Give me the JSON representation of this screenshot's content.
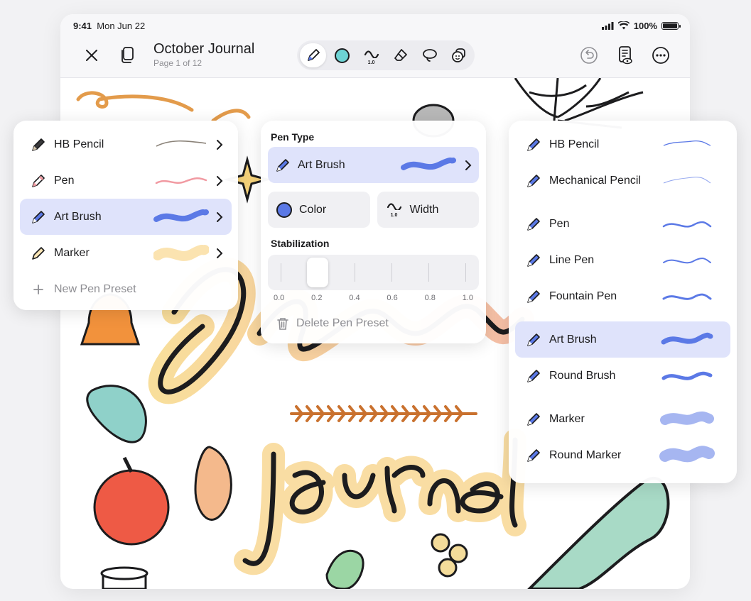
{
  "status": {
    "time": "9:41",
    "date": "Mon Jun 22",
    "battery": "100%"
  },
  "document": {
    "title": "October Journal",
    "subtitle": "Page 1 of 12"
  },
  "toolbar": {
    "width_value": "1.0"
  },
  "left_panel": {
    "items": [
      {
        "label": "HB Pencil",
        "selected": false
      },
      {
        "label": "Pen",
        "selected": false
      },
      {
        "label": "Art Brush",
        "selected": true
      },
      {
        "label": "Marker",
        "selected": false
      }
    ],
    "new_preset_label": "New Pen Preset"
  },
  "middle_panel": {
    "pen_type_heading": "Pen Type",
    "pen_type_value": "Art Brush",
    "color_label": "Color",
    "width_label": "Width",
    "width_badge": "1.0",
    "stabilization_heading": "Stabilization",
    "stabilization_value": 0.2,
    "scale": [
      "0.0",
      "0.2",
      "0.4",
      "0.6",
      "0.8",
      "1.0"
    ],
    "delete_label": "Delete Pen Preset"
  },
  "right_panel": {
    "items": [
      {
        "label": "HB Pencil"
      },
      {
        "label": "Mechanical Pencil"
      },
      {
        "label": "Pen"
      },
      {
        "label": "Line Pen"
      },
      {
        "label": "Fountain Pen"
      },
      {
        "label": "Art Brush",
        "selected": true
      },
      {
        "label": "Round Brush"
      },
      {
        "label": "Marker"
      },
      {
        "label": "Round Marker"
      }
    ]
  },
  "colors": {
    "accent": "#5b79e6",
    "selection": "#dfe3fb",
    "teal": "#6dd3d4"
  }
}
